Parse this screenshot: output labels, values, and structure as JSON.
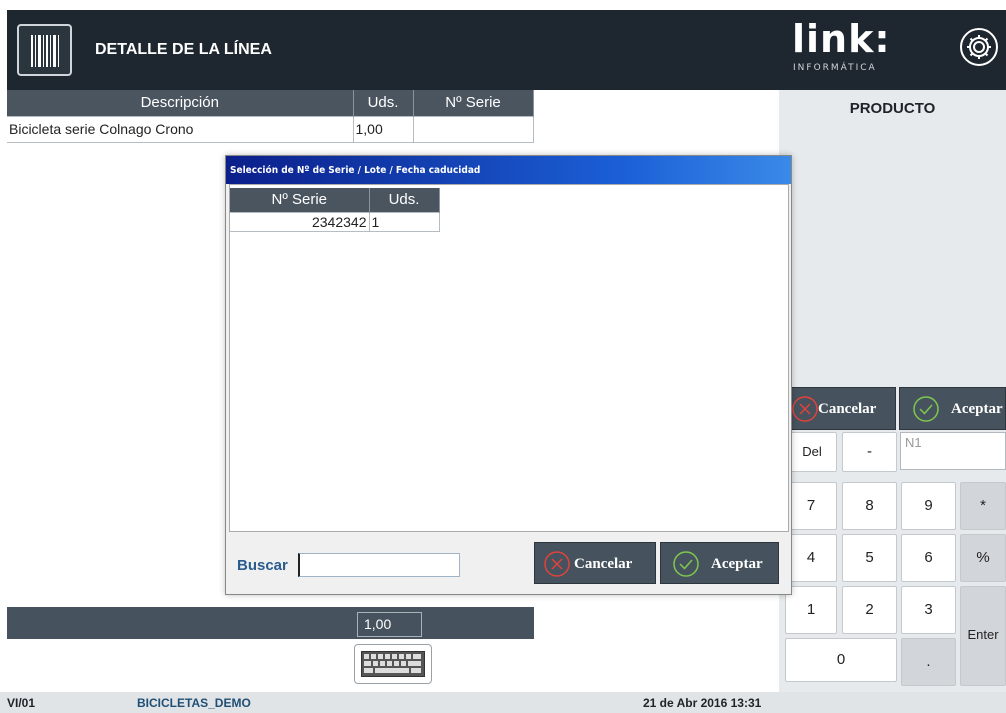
{
  "header": {
    "title": "DETALLE DE LA LÍNEA"
  },
  "brand": {
    "logo_text": "link:",
    "logo_sub": "INFORMÁTICA"
  },
  "right_panel": {
    "title": "PRODUCTO"
  },
  "line_table": {
    "columns": [
      "Descripción",
      "Uds.",
      "Nº Serie"
    ],
    "rows": [
      {
        "descripcion": "Bicicleta serie Colnago Crono",
        "uds": "1,00",
        "serie": ""
      }
    ]
  },
  "dialog": {
    "title": "Selección de Nº de Serie / Lote / Fecha caducidad",
    "columns": [
      "Nº Serie",
      "Uds."
    ],
    "rows": [
      {
        "serie": "2342342",
        "uds": "1"
      }
    ],
    "search_label": "Buscar",
    "search_value": "",
    "cancel_label": "Cancelar",
    "accept_label": "Aceptar"
  },
  "keypad": {
    "cancel_label": "Cancelar",
    "accept_label": "Aceptar",
    "del_label": "Del",
    "minus_label": "-",
    "input_placeholder": "N1",
    "keys": {
      "k7": "7",
      "k8": "8",
      "k9": "9",
      "mult": "*",
      "k4": "4",
      "k5": "5",
      "k6": "6",
      "pct": "%",
      "k1": "1",
      "k2": "2",
      "k3": "3",
      "enter": "Enter",
      "k0": "0",
      "dot": "."
    }
  },
  "total": {
    "value": "1,00"
  },
  "status": {
    "code": "VI/01",
    "database": "BICICLETAS_DEMO",
    "datetime": "21 de Abr 2016 13:31"
  },
  "colors": {
    "dark": "#1e272f",
    "button": "#46525d",
    "panel": "#e7eaec",
    "title_bar": "#1b5fd6"
  }
}
